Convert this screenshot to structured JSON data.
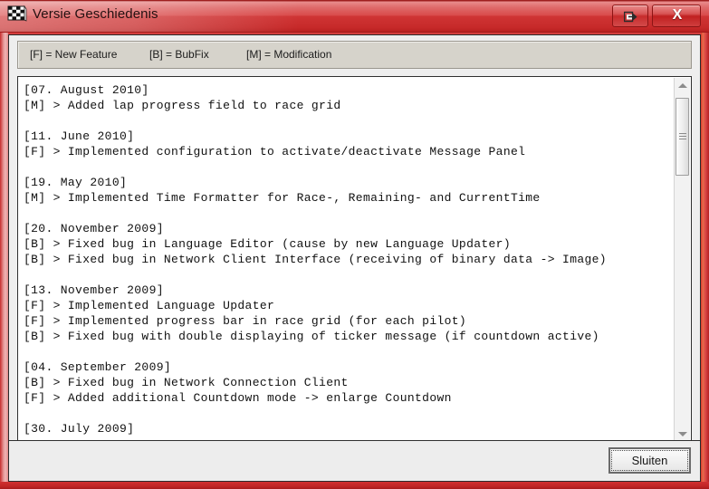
{
  "window": {
    "title": "Versie Geschiedenis",
    "icon": "checkered-flag-icon",
    "controls": {
      "restore_label": "❐",
      "close_label": "X"
    },
    "frame_color": "#c52c2c",
    "titlebar_text_color": "#241010"
  },
  "legend": {
    "items": [
      "[F] = New Feature",
      "[B] = BubFix",
      "[M] = Modification"
    ]
  },
  "log": {
    "text": "[07. August 2010]\n[M] > Added lap progress field to race grid\n\n[11. June 2010]\n[F] > Implemented configuration to activate/deactivate Message Panel\n\n[19. May 2010]\n[M] > Implemented Time Formatter for Race-, Remaining- and CurrentTime\n\n[20. November 2009]\n[B] > Fixed bug in Language Editor (cause by new Language Updater)\n[B] > Fixed bug in Network Client Interface (receiving of binary data -> Image)\n\n[13. November 2009]\n[F] > Implemented Language Updater\n[F] > Implemented progress bar in race grid (for each pilot)\n[B] > Fixed bug with double displaying of ticker message (if countdown active)\n\n[04. September 2009]\n[B] > Fixed bug in Network Connection Client\n[F] > Added additional Countdown mode -> enlarge Countdown\n\n[30. July 2009]",
    "entries": [
      {
        "date": "[07. August 2010]",
        "changes": [
          "[M] > Added lap progress field to race grid"
        ]
      },
      {
        "date": "[11. June 2010]",
        "changes": [
          "[F] > Implemented configuration to activate/deactivate Message Panel"
        ]
      },
      {
        "date": "[19. May 2010]",
        "changes": [
          "[M] > Implemented Time Formatter for Race-, Remaining- and CurrentTime"
        ]
      },
      {
        "date": "[20. November 2009]",
        "changes": [
          "[B] > Fixed bug in Language Editor (cause by new Language Updater)",
          "[B] > Fixed bug in Network Client Interface (receiving of binary data -> Image)"
        ]
      },
      {
        "date": "[13. November 2009]",
        "changes": [
          "[F] > Implemented Language Updater",
          "[F] > Implemented progress bar in race grid (for each pilot)",
          "[B] > Fixed bug with double displaying of ticker message (if countdown active)"
        ]
      },
      {
        "date": "[04. September 2009]",
        "changes": [
          "[B] > Fixed bug in Network Connection Client",
          "[F] > Added additional Countdown mode -> enlarge Countdown"
        ]
      },
      {
        "date": "[30. July 2009]",
        "changes": []
      }
    ]
  },
  "scrollbar": {
    "up_arrow": "▲",
    "down_arrow": "▼",
    "thumb_position_percent": 5
  },
  "footer": {
    "close_button_label": "Sluiten"
  }
}
